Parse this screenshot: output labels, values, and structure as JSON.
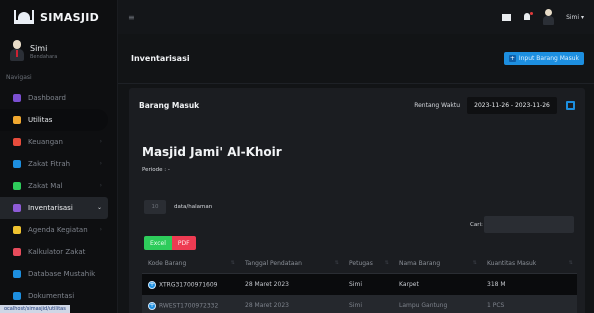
{
  "app": {
    "name": "SIMASJID"
  },
  "user": {
    "name": "Simi",
    "role": "Bendahara"
  },
  "sidebar": {
    "header": "Navigasi",
    "items": [
      {
        "label": "Dashboard",
        "color": "#7b4fd1"
      },
      {
        "label": "Utilitas",
        "color": "#f0a830"
      },
      {
        "label": "Keuangan",
        "color": "#e74c3c"
      },
      {
        "label": "Zakat Fitrah",
        "color": "#1d8fe0"
      },
      {
        "label": "Zakat Mal",
        "color": "#2ecc5b"
      },
      {
        "label": "Inventarisasi",
        "color": "#8e5bd6"
      },
      {
        "label": "Agenda Kegiatan",
        "color": "#f0c330"
      },
      {
        "label": "Kalkulator Zakat",
        "color": "#e74c5c"
      },
      {
        "label": "Database Mustahik",
        "color": "#1d8fe0"
      },
      {
        "label": "Dokumentasi",
        "color": "#1d8fe0"
      }
    ]
  },
  "status_url": "ocalhost/simasjid/utilitas",
  "topbar": {
    "user": "Simi"
  },
  "page": {
    "title": "Inventarisasi",
    "input_button": "Input Barang Masuk"
  },
  "card": {
    "title": "Barang Masuk",
    "range_label": "Rentang Waktu",
    "range_value": "2023-11-26 - 2023-11-26",
    "mosque": "Masjid Jami' Al-Khoir",
    "periode": "Periode : -",
    "length_value": "10",
    "length_label": "data/halaman",
    "search_label": "Cari:",
    "excel": "Excel",
    "pdf": "PDF"
  },
  "table": {
    "headers": [
      "Kode Barang",
      "Tanggal Pendataan",
      "Petugas",
      "Nama Barang",
      "Kuantitas Masuk"
    ],
    "rows": [
      [
        "XTRG31700971609",
        "28 Maret 2023",
        "Simi",
        "Karpet",
        "318 M"
      ],
      [
        "RWEST1700972332",
        "28 Maret 2023",
        "Simi",
        "Lampu Gantung",
        "1 PCS"
      ]
    ]
  }
}
